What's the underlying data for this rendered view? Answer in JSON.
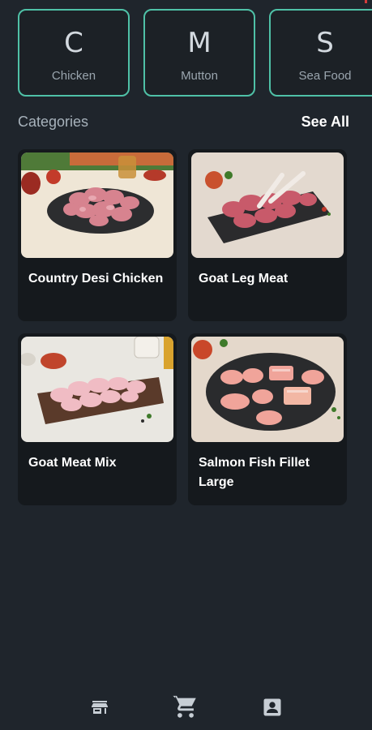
{
  "quick_categories": [
    {
      "letter": "C",
      "label": "Chicken"
    },
    {
      "letter": "M",
      "label": "Mutton"
    },
    {
      "letter": "S",
      "label": "Sea Food"
    }
  ],
  "section": {
    "title": "Categories",
    "see_all": "See All"
  },
  "products": [
    {
      "title": "Country Desi Chicken"
    },
    {
      "title": "Goat Leg Meat"
    },
    {
      "title": "Goat Meat Mix"
    },
    {
      "title": "Salmon Fish Fillet Large"
    }
  ],
  "nav": [
    {
      "icon": "store-icon"
    },
    {
      "icon": "cart-icon"
    },
    {
      "icon": "account-box-icon"
    }
  ],
  "colors": {
    "background": "#1f252c",
    "card": "#15191d",
    "accent_border": "#4fc1a7",
    "nav_icon": "#c7ced5"
  }
}
